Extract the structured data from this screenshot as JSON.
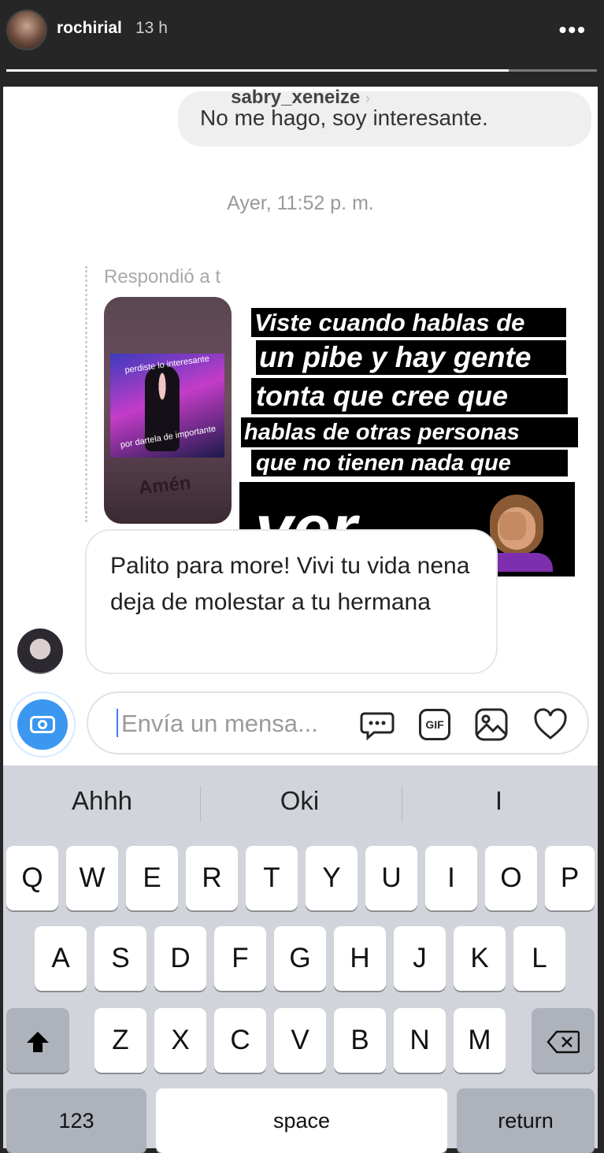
{
  "story": {
    "username": "rochirial",
    "time_ago": "13 h",
    "more_label": "•••",
    "progress": 0.85
  },
  "chat": {
    "contact_name": "sabry_xeneize",
    "contact_chevron": "›",
    "previous_message": "No me hago, soy interesante.",
    "timestamp": "Ayer, 11:52 p. m.",
    "reply_label": "Respondió a t",
    "story_thumbnail": {
      "arc_text_top": "perdiste lo interesante",
      "arc_text_bottom": "por dartela de importante",
      "caption": "Amén"
    },
    "incoming_message": "Palito para more! Vivi tu vida nena deja de molestar a tu hermana"
  },
  "sticker_text": {
    "line1": "Viste cuando hablas de",
    "line2": "un pibe y hay gente",
    "line3": "tonta que cree que",
    "line4": "hablas de otras personas",
    "line5": "que no tienen nada que",
    "line6": "ver...",
    "emoji": "face-palm-emoji"
  },
  "composer": {
    "placeholder": "Envía un mensa...",
    "icons": [
      "chat-bubble-icon",
      "gif-icon",
      "image-icon",
      "heart-icon"
    ],
    "gif_label": "GIF",
    "camera_icon": "camera-icon"
  },
  "keyboard": {
    "suggestions": [
      "Ahhh",
      "Oki",
      "I"
    ],
    "row1": [
      "Q",
      "W",
      "E",
      "R",
      "T",
      "Y",
      "U",
      "I",
      "O",
      "P"
    ],
    "row2": [
      "A",
      "S",
      "D",
      "F",
      "G",
      "H",
      "J",
      "K",
      "L"
    ],
    "row3": [
      "Z",
      "X",
      "C",
      "V",
      "B",
      "N",
      "M"
    ],
    "numbers_label": "123",
    "space_label": "space",
    "return_label": "return"
  },
  "colors": {
    "accent_blue": "#3b97f0",
    "story_bg": "#262626",
    "keyboard_bg": "#d1d4da",
    "sticker_bg": "#000000"
  }
}
